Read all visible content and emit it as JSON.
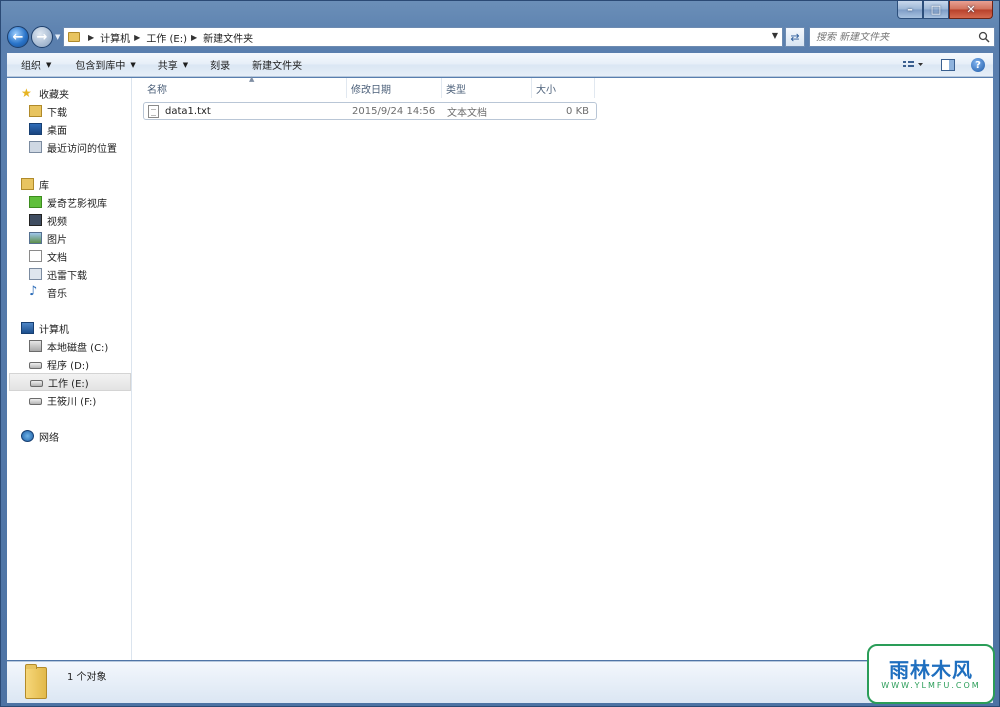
{
  "address": {
    "crumbs": [
      "计算机",
      "工作 (E:)",
      "新建文件夹"
    ]
  },
  "search": {
    "placeholder": "搜索 新建文件夹"
  },
  "toolbar": {
    "organize": "组织",
    "include_in_library": "包含到库中",
    "share": "共享",
    "burn": "刻录",
    "new_folder": "新建文件夹"
  },
  "sidebar": {
    "favorites": {
      "title": "收藏夹",
      "items": [
        "下载",
        "桌面",
        "最近访问的位置"
      ]
    },
    "libraries": {
      "title": "库",
      "items": [
        "爱奇艺影视库",
        "视频",
        "图片",
        "文档",
        "迅雷下载",
        "音乐"
      ]
    },
    "computer": {
      "title": "计算机",
      "items": [
        "本地磁盘 (C:)",
        "程序 (D:)",
        "工作 (E:)",
        "王筱川 (F:)"
      ]
    },
    "network": {
      "title": "网络"
    }
  },
  "columns": {
    "name": "名称",
    "date_modified": "修改日期",
    "type": "类型",
    "size": "大小"
  },
  "files": [
    {
      "name": "data1.txt",
      "date_modified": "2015/9/24 14:56",
      "type": "文本文档",
      "size": "0 KB"
    }
  ],
  "status": {
    "item_count": "1 个对象"
  },
  "watermark": {
    "main": "雨林木风",
    "url": "WWW.YLMFU.COM"
  }
}
